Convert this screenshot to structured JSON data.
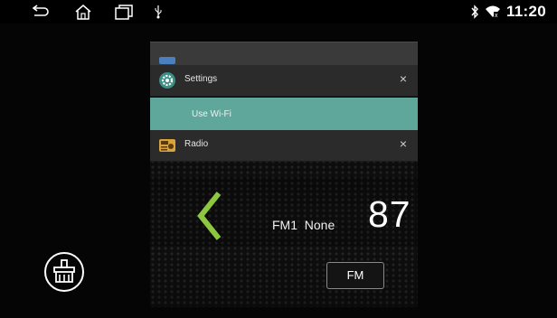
{
  "status_bar": {
    "time": "11:20",
    "nav_icons": [
      "back-icon",
      "home-icon",
      "recents-icon"
    ],
    "notification_icons": [
      "usb-icon"
    ],
    "system_icons": [
      "bluetooth-icon",
      "wifi-icon"
    ]
  },
  "recents": {
    "cards": [
      {
        "title": "Settings",
        "icon": "settings-icon",
        "close": "×"
      },
      {
        "title": "Radio",
        "icon": "radio-icon",
        "close": "×"
      }
    ],
    "settings_preview_item": "Use Wi-Fi"
  },
  "radio": {
    "band_text": "FM1  None",
    "frequency": "87",
    "band_button": "FM"
  },
  "colors": {
    "accent_green": "#8dc63f",
    "settings_teal": "#5fa79a"
  }
}
